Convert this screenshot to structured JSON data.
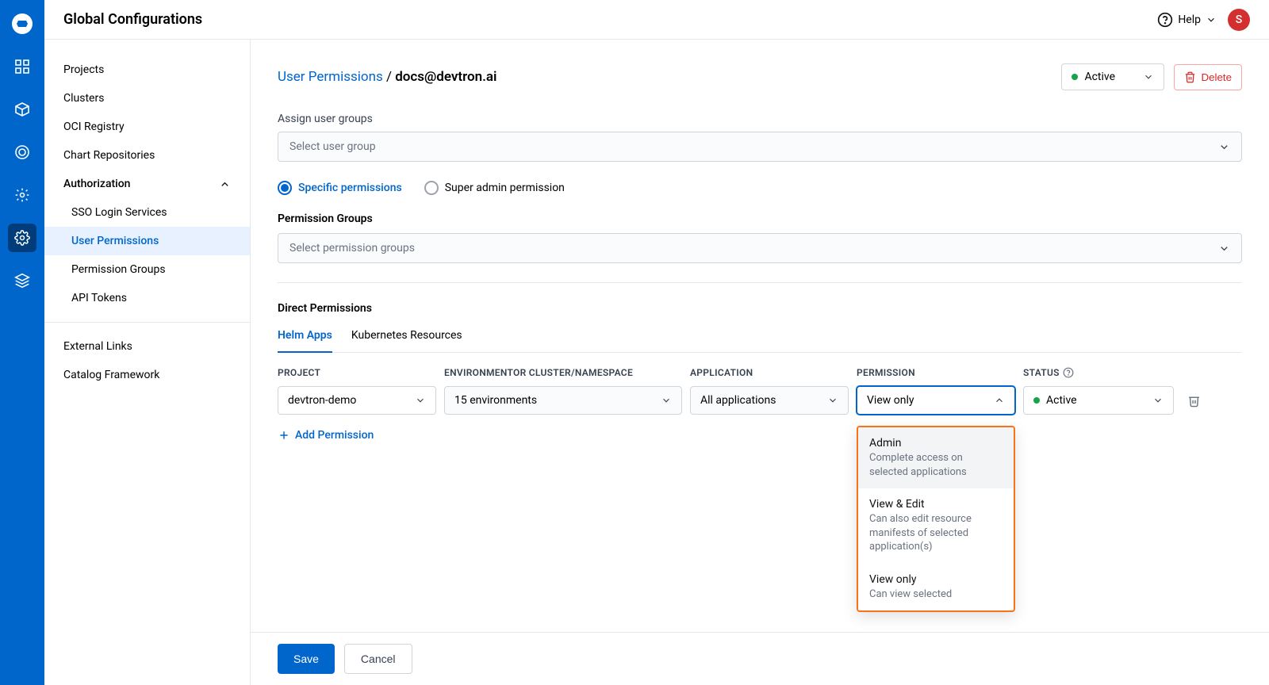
{
  "header": {
    "title": "Global Configurations",
    "help": "Help",
    "avatar_initial": "S"
  },
  "sidebar": {
    "items": [
      {
        "label": "Projects"
      },
      {
        "label": "Clusters"
      },
      {
        "label": "OCI Registry"
      },
      {
        "label": "Chart Repositories"
      },
      {
        "label": "Authorization",
        "expanded": true
      },
      {
        "label": "External Links"
      },
      {
        "label": "Catalog Framework"
      }
    ],
    "auth_children": [
      {
        "label": "SSO Login Services"
      },
      {
        "label": "User Permissions",
        "active": true
      },
      {
        "label": "Permission Groups"
      },
      {
        "label": "API Tokens"
      }
    ]
  },
  "page": {
    "breadcrumb_parent": "User Permissions",
    "breadcrumb_current": "docs@devtron.ai",
    "status": "Active",
    "delete_label": "Delete",
    "assign_groups_label": "Assign user groups",
    "assign_groups_placeholder": "Select user group",
    "radio_specific": "Specific permissions",
    "radio_super": "Super admin permission",
    "perm_groups_heading": "Permission Groups",
    "perm_groups_placeholder": "Select permission groups",
    "direct_heading": "Direct Permissions",
    "tabs": {
      "helm": "Helm Apps",
      "k8s": "Kubernetes Resources"
    },
    "columns": {
      "project": "PROJECT",
      "env": "ENVIRONMENTOR CLUSTER/NAMESPACE",
      "app": "APPLICATION",
      "permission": "PERMISSION",
      "status": "STATUS"
    },
    "row": {
      "project": "devtron-demo",
      "env": "15 environments",
      "app": "All applications",
      "permission": "View only",
      "status": "Active"
    },
    "add_permission": "Add Permission",
    "footer": {
      "save": "Save",
      "cancel": "Cancel"
    },
    "dropdown": {
      "options": [
        {
          "title": "Admin",
          "desc": "Complete access on selected applications"
        },
        {
          "title": "View & Edit",
          "desc": "Can also edit resource manifests of selected application(s)"
        },
        {
          "title": "View only",
          "desc": "Can view selected"
        }
      ]
    }
  }
}
